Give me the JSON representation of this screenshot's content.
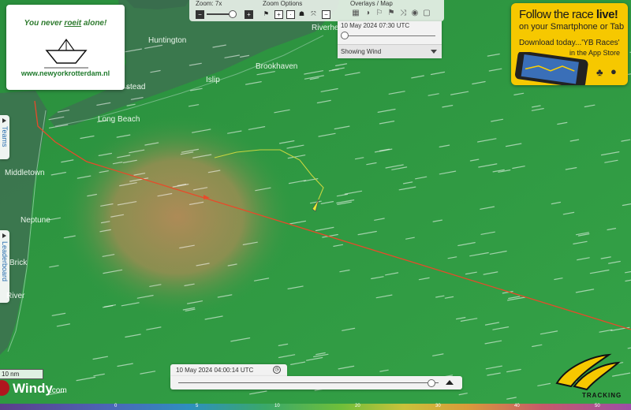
{
  "map": {
    "places": [
      {
        "name": "Huntington"
      },
      {
        "name": "Riverhead"
      },
      {
        "name": "Brookhaven"
      },
      {
        "name": "Islip"
      },
      {
        "name": "Long Beach"
      },
      {
        "name": "Middletown"
      },
      {
        "name": "Neptune"
      },
      {
        "name": "Brick"
      },
      {
        "name": "River"
      },
      {
        "name": "stead"
      }
    ]
  },
  "promo": {
    "tagline_pre": "You never ",
    "tagline_link": "roeit",
    "tagline_post": " alone!",
    "url": "www.newyorkrotterdam.nl"
  },
  "controls": {
    "zoom_label": "Zoom: 7x",
    "zoom_options_label": "Zoom Options",
    "overlays_label": "Overlays / Map"
  },
  "time_panel": {
    "timestamp": "10 May 2024 07:30 UTC",
    "overlay_select": "Showing Wind"
  },
  "ad": {
    "headline_pre": "Follow the race ",
    "headline_bold": "live!",
    "subline": "on your Smartphone or Tab",
    "download_line": "Download today...'YB Races'",
    "store_line": "in the App Store"
  },
  "side_tabs": {
    "teams": "Teams",
    "leaderboard": "Leaderboard"
  },
  "scale": {
    "label": "10 nm"
  },
  "windy": {
    "name": "Windy",
    "suffix": ".com"
  },
  "timeline": {
    "timestamp": "10 May 2024 04:00:14 UTC",
    "position": 0.97
  },
  "yb_logo": {
    "text": "TRACKING"
  },
  "legend": {
    "ticks": [
      "",
      "0",
      "5",
      "10",
      "20",
      "30",
      "40",
      "50"
    ]
  },
  "colors": {
    "sea": "#2f9a44",
    "land": "#3c6e4e",
    "calm_zone": "#b08a5a",
    "route_line": "#e84a2a",
    "boat_track": "#c8d640",
    "ad_bg": "#f6c800"
  }
}
